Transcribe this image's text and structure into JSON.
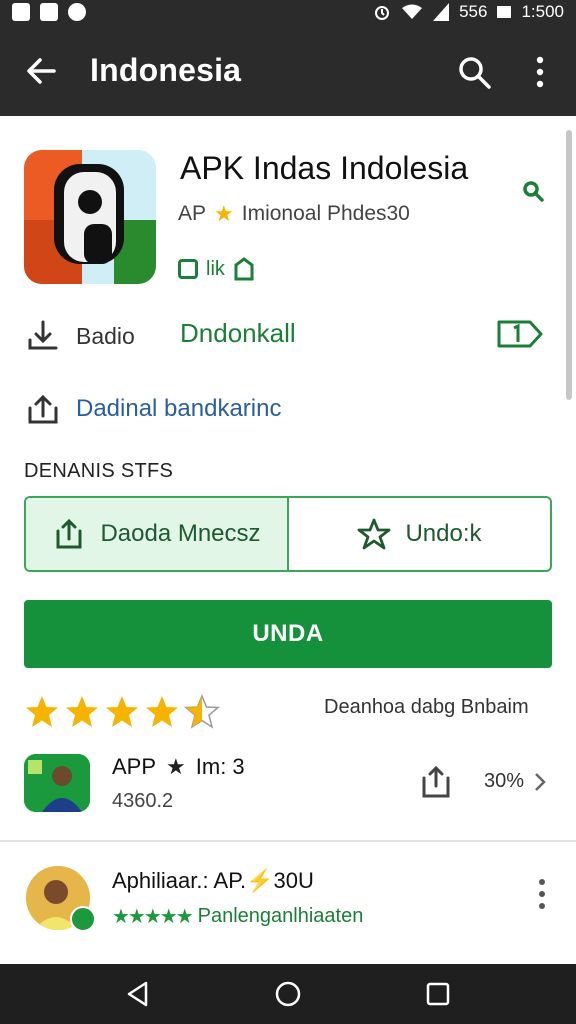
{
  "status_bar": {
    "signal_text": "556",
    "time": "1:500"
  },
  "app_bar": {
    "title": "Indonesia",
    "icons": [
      "back-arrow-icon",
      "search-icon",
      "more-vert-icon"
    ]
  },
  "app": {
    "title": "APK Indas Indolesia",
    "subtitle_prefix": "AP",
    "subtitle_rest": "Imionoal Phdes30",
    "badge_text": "lik",
    "icon": "app-icon"
  },
  "rows": {
    "row1_label": "Badio",
    "row1_value": "Dndonkall",
    "row2_label": "Dadinal bandkarinc"
  },
  "section": {
    "label": "DENANIS STFS"
  },
  "segmented": {
    "left_label": "Daoda Mnecsz",
    "right_label": "Undo:k"
  },
  "primary_button": {
    "label": "UNDA"
  },
  "rating": {
    "stars": 4.5,
    "max": 5,
    "caption": "Deanhoa dabg Bnbaim"
  },
  "developer": {
    "name": "APP",
    "rating_text": "Im: 3",
    "count": "4360.2",
    "percent": "30%"
  },
  "review": {
    "author": "Aphiliaar.: AP.⚡30U",
    "stars_glyph": "★★★★★",
    "text": "Panlenganlhiaaten"
  },
  "colors": {
    "bar": "#2b2b2b",
    "accent_green": "#14913a",
    "green_text": "#1a7f37",
    "link_blue": "#2a5ea0",
    "star": "#f6b400"
  }
}
